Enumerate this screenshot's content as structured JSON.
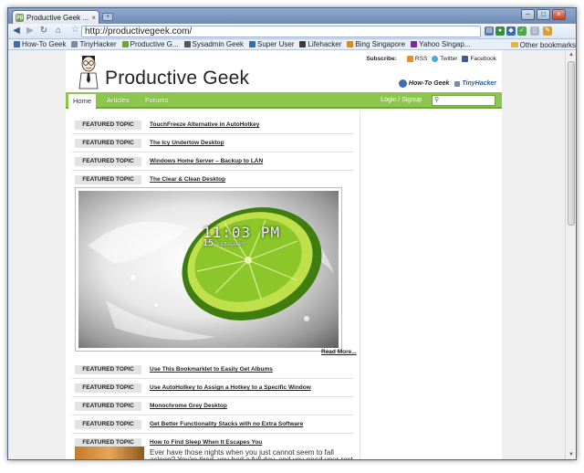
{
  "browser": {
    "tab_title": "Productive Geek ...",
    "tab_favicon": "pg",
    "tab_close": "×",
    "new_tab": "+",
    "address": "http://productivegeek.com/",
    "window_controls": [
      "–",
      "□",
      "×"
    ],
    "bookmarks": [
      {
        "label": "How-To Geek",
        "color": "#3b6db3"
      },
      {
        "label": "TinyHacker",
        "color": "#7a8aa8"
      },
      {
        "label": "Productive G...",
        "color": "#6fa23a"
      },
      {
        "label": "Sysadmin Geek",
        "color": "#555555"
      },
      {
        "label": "Super User",
        "color": "#2d6fb8"
      },
      {
        "label": "Lifehacker",
        "color": "#3b3b3b"
      },
      {
        "label": "Bing Singapore",
        "color": "#e08a1e"
      },
      {
        "label": "Yahoo Singap...",
        "color": "#7a2c9a"
      }
    ],
    "other_bookmarks": "Other bookmarks"
  },
  "site": {
    "title": "Productive Geek",
    "subscribe_label": "Subscribe:",
    "subscribe": [
      {
        "label": "RSS",
        "color": "#f08a24"
      },
      {
        "label": "Twitter",
        "color": "#4aa8e0"
      },
      {
        "label": "Facebook",
        "color": "#3b5998"
      }
    ],
    "partners": [
      "How-To Geek",
      "TinyHacker"
    ],
    "nav": [
      "Home",
      "Articles",
      "Forums"
    ],
    "login": "Login / Signup",
    "search_placeholder": "",
    "accent": "#8cc64f"
  },
  "featured": {
    "badge": "FEATURED TOPIC",
    "items_top": [
      "TouchFreeze Alternative in AutoHotkey",
      "The Icy Undertow Desktop",
      "Windows Home Server – Backup to LAN",
      "The Clear & Clean Desktop"
    ],
    "image_clock": "11:03 PM",
    "image_date": "15",
    "image_month": "FEBRUARY",
    "read_more": "Read More...",
    "items_bottom": [
      "Use This Bookmarklet to Easily Get Albums",
      "Use AutoHotkey to Assign a Hotkey to a Specific Window",
      "Monochrome Grey Desktop",
      "Get Better Functionality Stacks with no Extra Software",
      "How to Find Sleep When It Escapes You"
    ],
    "excerpt": "Ever have those nights when you just cannot seem to fall asleep? You're tired, you had a full day, and you need your rest in order"
  }
}
